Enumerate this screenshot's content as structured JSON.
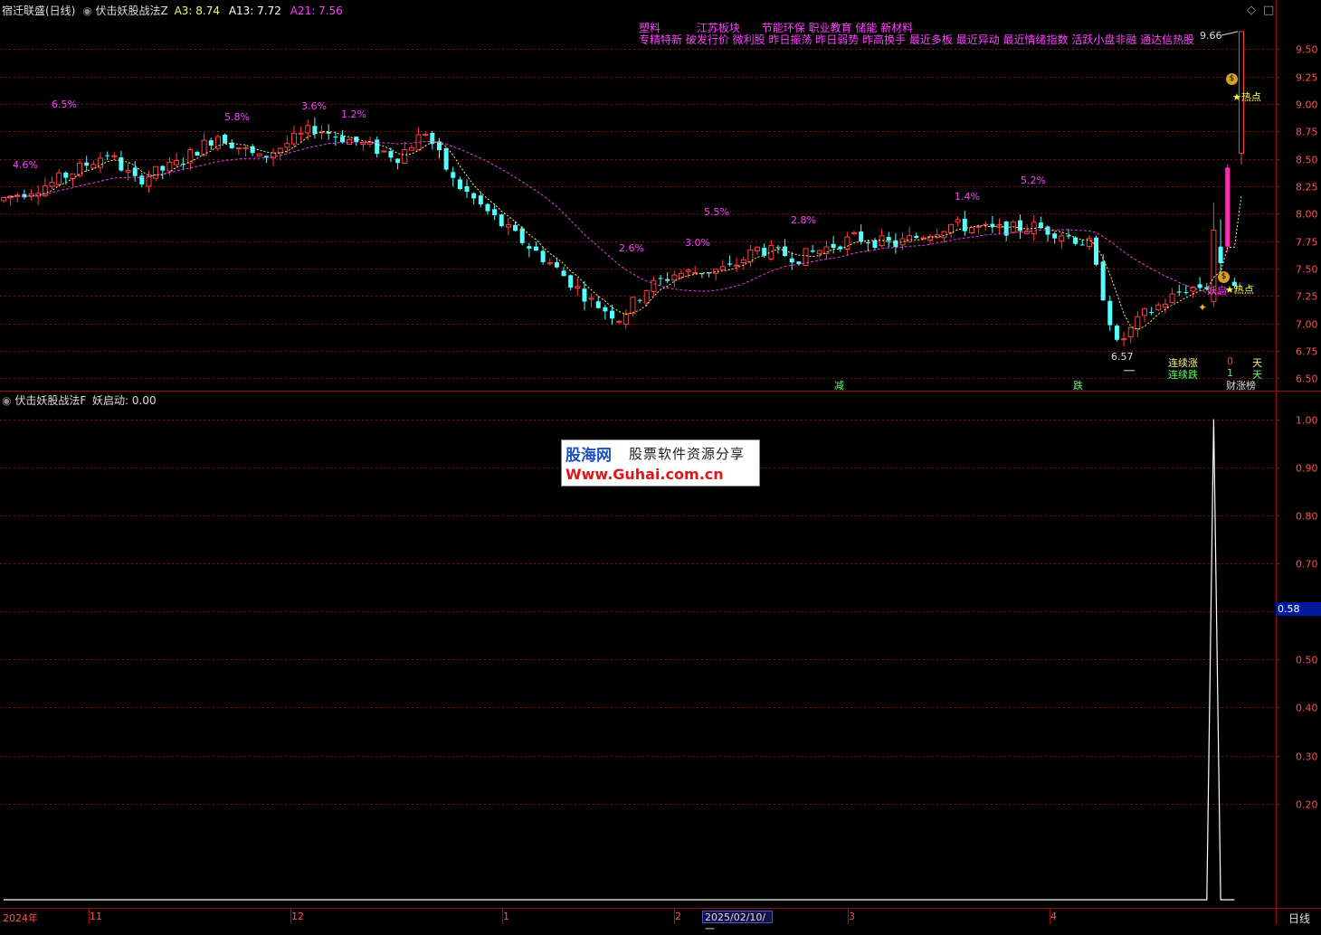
{
  "header": {
    "stock": "宿迁联盛(日线)",
    "indicator_name": "伏击妖股战法Z",
    "a3_label": "A3: 8.74",
    "a13_label": "A13: 7.72",
    "a21_label": "A21: 7.56"
  },
  "sub_header": {
    "indicator_name": "伏击妖股战法F",
    "value_label": "妖启动: 0.00"
  },
  "concepts_line1": [
    "塑料",
    "江苏板块",
    "节能环保 职业教育 储能 新材料"
  ],
  "concepts_line2": "专精特新 破发行价 微利股 昨日振荡 昨日弱势 昨高换手 最近多板 最近异动 最近情绪指数 活跃小盘非融 通达信热股",
  "right_panel": {
    "up_label": "连续涨",
    "up_value": "0",
    "up_unit": "天",
    "down_label": "连续跌",
    "down_value": "1",
    "down_unit": "天",
    "bottom_label": "财涨榜"
  },
  "markers": {
    "reduce": "减",
    "fall": "跌",
    "hot1": "★热点",
    "hot2": "★热点",
    "demon": "妖启",
    "money": "$"
  },
  "price_labels": {
    "high": "9.66",
    "low": "6.57"
  },
  "pct_labels": [
    "6.5%",
    "4.6%",
    "5.8%",
    "3.6%",
    "1.2%",
    "5.5%",
    "2.6%",
    "3.0%",
    "2.8%",
    "1.4%",
    "5.2%"
  ],
  "x_axis": {
    "labels": [
      "2024年",
      "11",
      "12",
      "1",
      "2",
      "3",
      "4"
    ],
    "current_date": "2025/02/10/一",
    "period": "日线"
  },
  "sub_cursor": "0.58",
  "watermark": {
    "brand": "股海网",
    "tagline": "股票软件资源分享",
    "url": "Www.Guhai.com.cn"
  },
  "colors": {
    "up": "#ff3c3c",
    "down": "#54ffff",
    "ma_short": "#f5f57a",
    "ma_long": "#e040e0",
    "concept": "#ff40ff",
    "grid": "#8a1010",
    "highlight": "#ff2db4"
  },
  "chart_data": [
    {
      "type": "candlestick",
      "y_axis": {
        "ticks": [
          6.5,
          6.75,
          7.0,
          7.25,
          7.5,
          7.75,
          8.0,
          8.25,
          8.5,
          8.75,
          9.0,
          9.25,
          9.5
        ],
        "ylim": [
          6.42,
          9.8
        ]
      },
      "last": {
        "open": 8.55,
        "high": 9.66,
        "low": 8.45,
        "close": 9.66
      },
      "high_marker": 9.66,
      "low_marker": 6.57,
      "series": [
        {
          "name": "A3",
          "value": 8.74
        },
        {
          "name": "A13",
          "value": 7.72
        },
        {
          "name": "A21",
          "value": 7.56
        }
      ]
    },
    {
      "type": "line",
      "series": [
        {
          "name": "妖启动",
          "values_note": "0 everywhere except a single spike of 1.00 near the last bars"
        }
      ],
      "y_axis": {
        "ticks": [
          0.2,
          0.3,
          0.4,
          0.5,
          0.6,
          0.7,
          0.8,
          0.9,
          1.0
        ],
        "ylim": [
          0,
          1.02
        ]
      },
      "peak": 1.0,
      "current": 0.0
    }
  ]
}
